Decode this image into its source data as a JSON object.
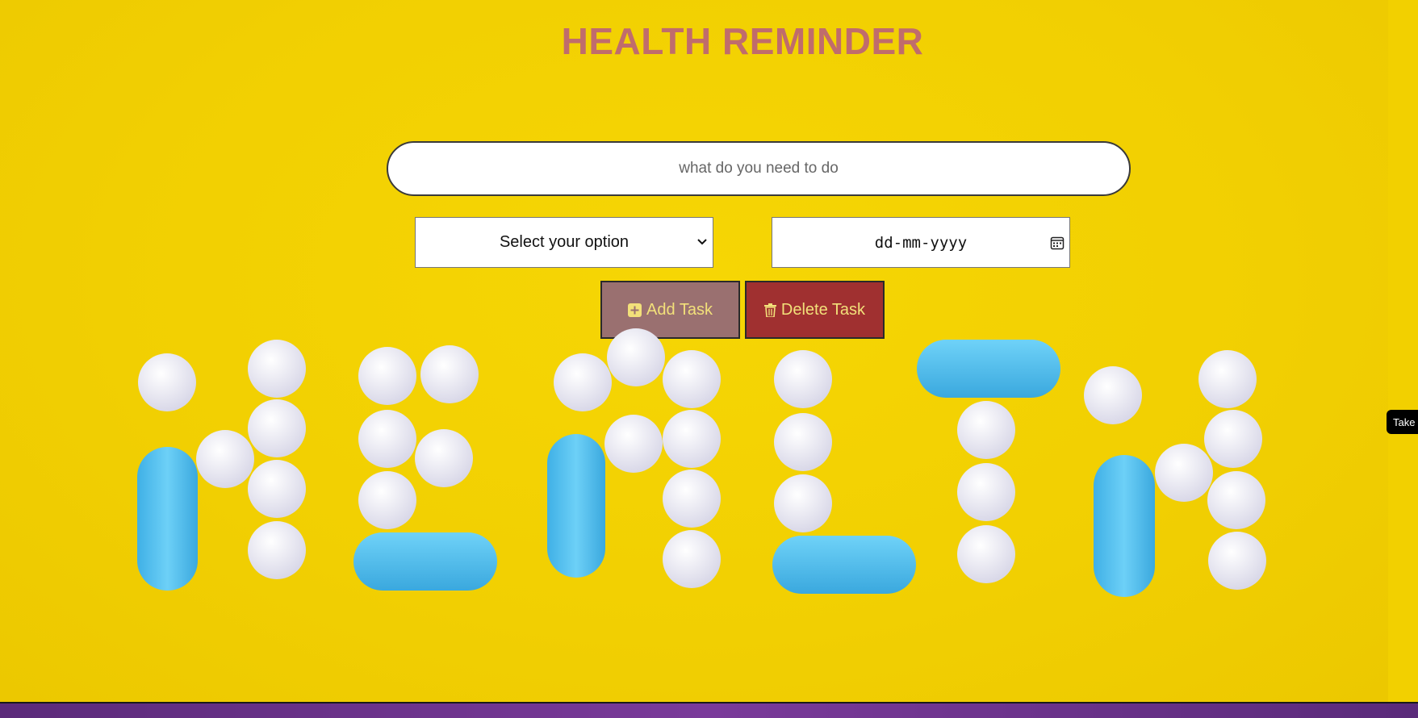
{
  "page": {
    "title": "HEALTH REMINDER"
  },
  "form": {
    "task_placeholder": "what do you need to do",
    "select_value": "Select your option",
    "date_value": "dd-mm-yyyy"
  },
  "buttons": {
    "add_label": "Add Task",
    "delete_label": "Delete Task"
  },
  "side_tab": {
    "label": "Take"
  },
  "colors": {
    "background": "#f2d000",
    "title": "#c06c6c",
    "add_button": "#9a7070",
    "delete_button": "#a03030",
    "button_text": "#f2e07a",
    "pill_white": "#ecebf4",
    "pill_blue": "#55c2ee"
  },
  "icons": [
    "plus-square-icon",
    "trash-icon",
    "chevron-down-icon",
    "calendar-icon"
  ]
}
